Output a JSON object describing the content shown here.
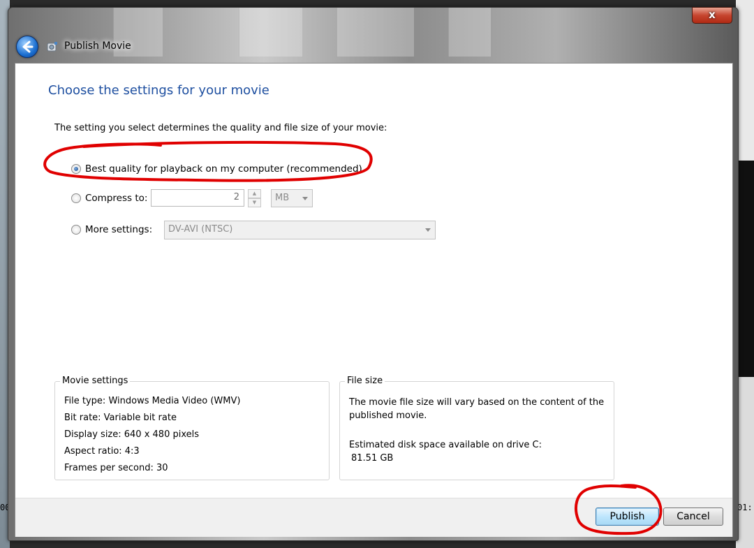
{
  "window": {
    "title": "Publish Movie",
    "close_glyph": "x"
  },
  "icons": {
    "back": "back-arrow-icon",
    "app": "movie-maker-icon",
    "close": "close-icon"
  },
  "background": {
    "left_time": "00",
    "right_time": "01:"
  },
  "page": {
    "heading": "Choose the settings for your movie",
    "instruction": "The setting you select determines the quality and file size of your movie:"
  },
  "options": {
    "best_quality": {
      "label": "Best quality for playback on my computer (recommended)",
      "selected": true
    },
    "compress": {
      "label": "Compress to:",
      "value": "2",
      "unit": "MB",
      "selected": false
    },
    "more": {
      "label": "More settings:",
      "value": "DV-AVI (NTSC)",
      "selected": false
    }
  },
  "movie_settings": {
    "legend": "Movie settings",
    "lines": [
      "File type: Windows Media Video (WMV)",
      "Bit rate: Variable bit rate",
      "Display size: 640 x 480 pixels",
      "Aspect ratio: 4:3",
      "Frames per second: 30"
    ]
  },
  "file_size": {
    "legend": "File size",
    "description": "The movie file size will vary based on the content of the published movie.",
    "disk_label": "Estimated disk space available on drive C:",
    "disk_value": "81.51 GB"
  },
  "buttons": {
    "publish": "Publish",
    "cancel": "Cancel"
  },
  "colors": {
    "heading": "#1e4fa0",
    "annotation": "#e00000"
  }
}
